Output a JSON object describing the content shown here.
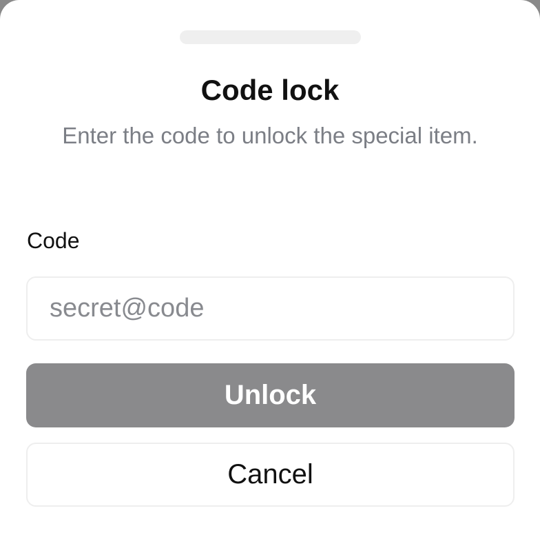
{
  "dialog": {
    "title": "Code lock",
    "subtitle": "Enter the code to unlock the special item.",
    "field_label": "Code",
    "input": {
      "value": "",
      "placeholder": "secret@code"
    },
    "unlock_label": "Unlock",
    "cancel_label": "Cancel"
  },
  "colors": {
    "unlock_button_bg": "#8a8a8c",
    "subtitle_text": "#7b7e85",
    "border": "#eeeeee"
  }
}
